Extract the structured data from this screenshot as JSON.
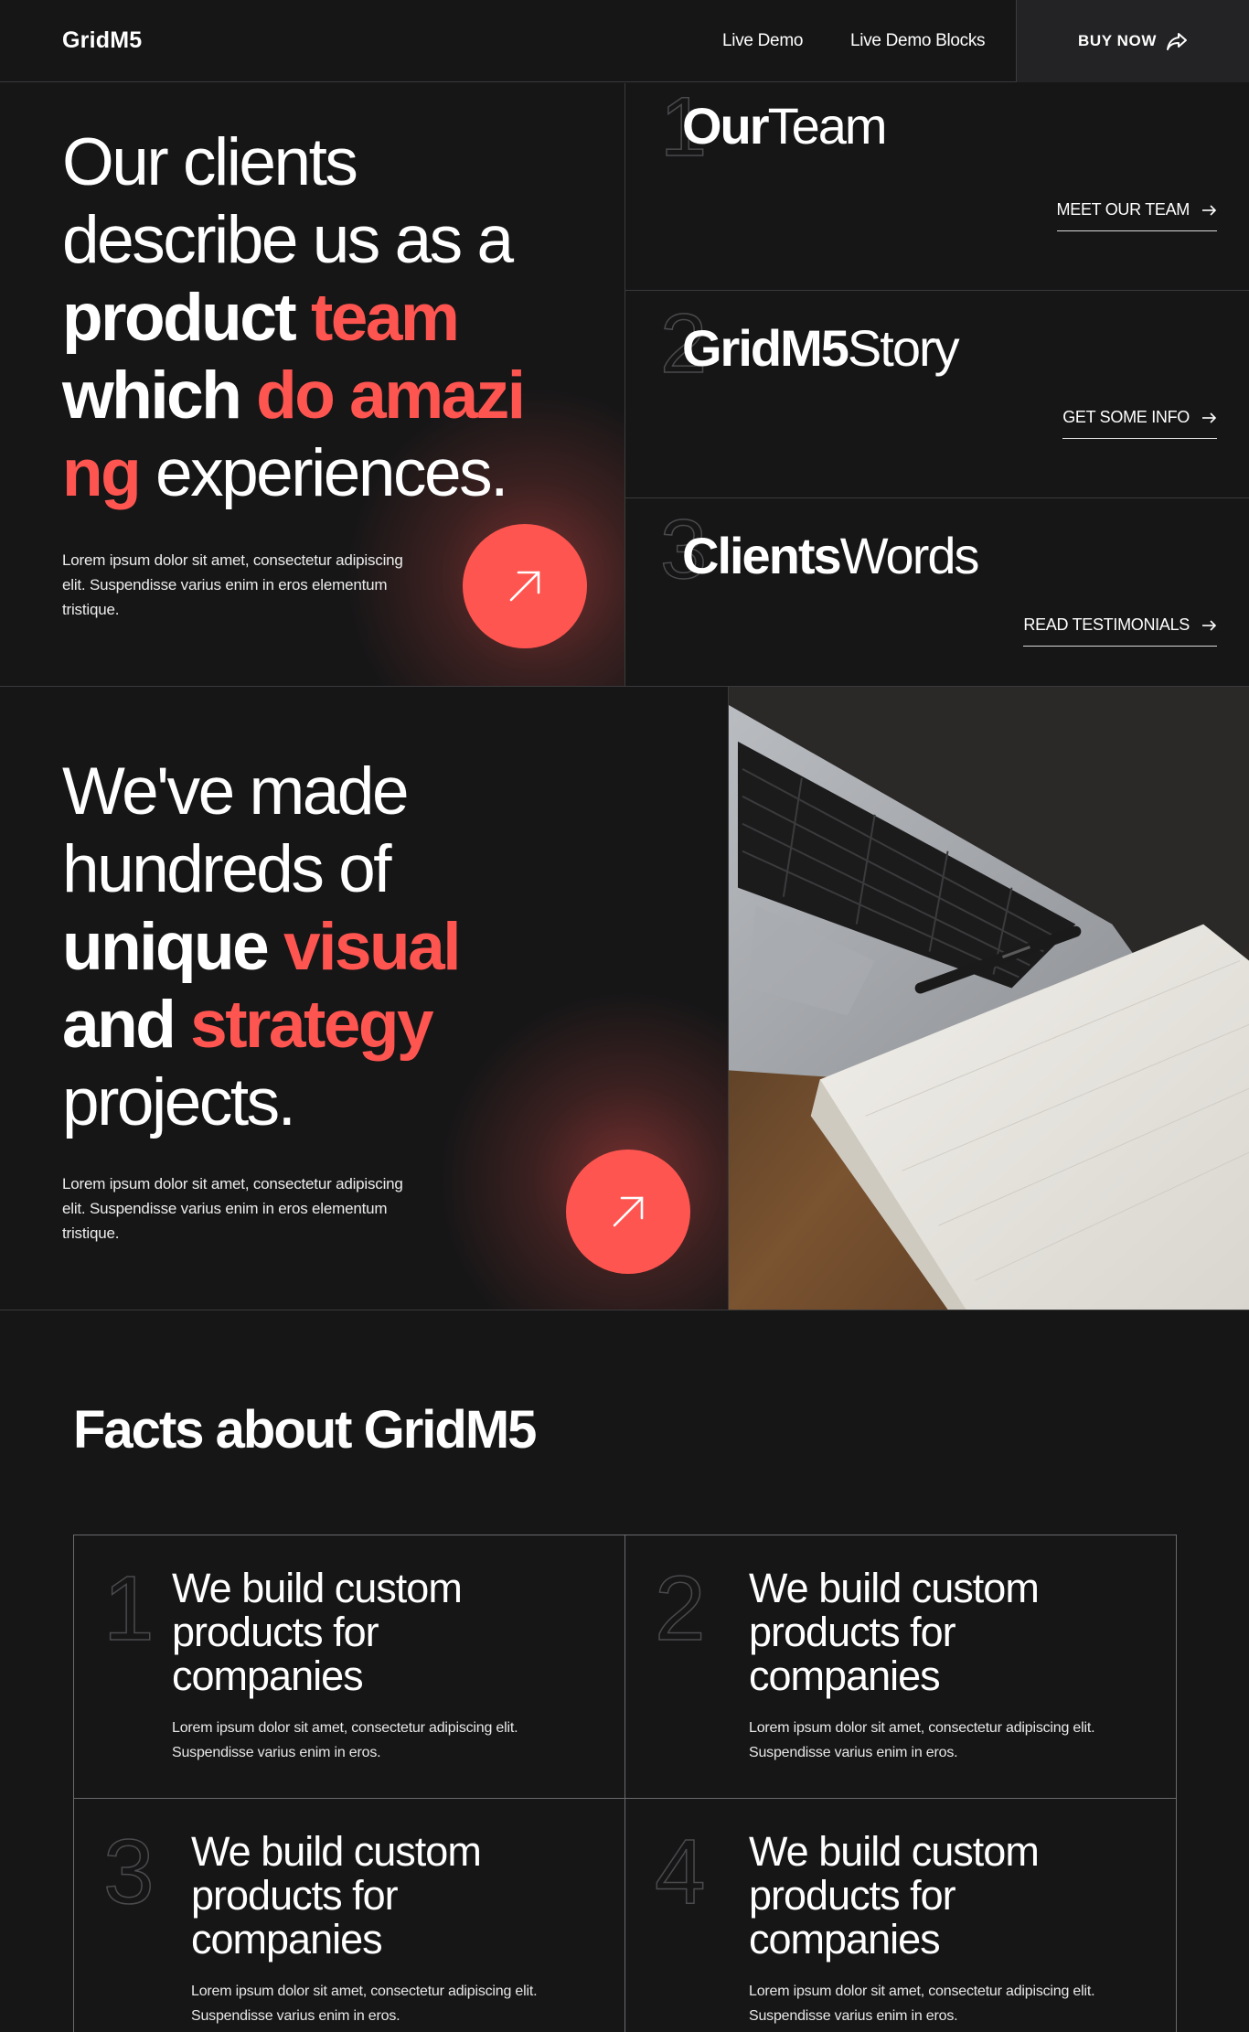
{
  "nav": {
    "logo": "GridM5",
    "links": [
      "Live Demo",
      "Live Demo Blocks"
    ],
    "buy_label": "BUY NOW"
  },
  "hero": {
    "line1": "Our clients",
    "line2": "describe us as a",
    "w_product": "product",
    "w_team": "team",
    "w_which": "which",
    "w_do_amazing_1": "do amazi",
    "w_do_amazing_2": "ng",
    "w_experiences": "experiences.",
    "body": "Lorem ipsum dolor sit amet, consectetur adipiscing elit. Suspendisse varius enim in eros elementum tristique."
  },
  "cards": [
    {
      "num": "1",
      "title_bold": "Our",
      "title_rest": "Team",
      "cta": "MEET OUR TEAM"
    },
    {
      "num": "2",
      "title_bold": "GridM5",
      "title_rest": "Story",
      "cta": "GET SOME INFO"
    },
    {
      "num": "3",
      "title_bold": "Clients",
      "title_rest": "Words",
      "cta": "READ TESTIMONIALS"
    }
  ],
  "projects": {
    "line1": "We've made",
    "line2": "hundreds of",
    "w_unique": "unique",
    "w_visual": "visual",
    "w_and": "and",
    "w_strategy": "strategy",
    "w_projects": "projects.",
    "body": "Lorem ipsum dolor sit amet, consectetur adipiscing elit. Suspendisse varius enim in eros elementum tristique."
  },
  "facts": {
    "title_regular": "Facts about",
    "title_bold": "GridM5",
    "items": [
      {
        "num": "1",
        "heading": "We build custom products for companies",
        "body": "Lorem ipsum dolor sit amet, consectetur adipiscing elit. Suspendisse varius enim in eros."
      },
      {
        "num": "2",
        "heading": "We build custom products for companies",
        "body": "Lorem ipsum dolor sit amet, consectetur adipiscing elit. Suspendisse varius enim in eros."
      },
      {
        "num": "3",
        "heading": "We build custom products for companies",
        "body": "Lorem ipsum dolor sit amet, consectetur adipiscing elit. Suspendisse varius enim in eros."
      },
      {
        "num": "4",
        "heading": "We build custom products for companies",
        "body": "Lorem ipsum dolor sit amet, consectetur adipiscing elit. Suspendisse varius enim in eros."
      }
    ]
  },
  "colors": {
    "accent": "#ff5550",
    "background": "#161617",
    "border": "#3a3a3c"
  },
  "icons": {
    "buy": "share-arrow-icon",
    "circle": "arrow-up-right-icon",
    "cta": "arrow-right-icon",
    "photo": "laptop-notebook-photo"
  }
}
